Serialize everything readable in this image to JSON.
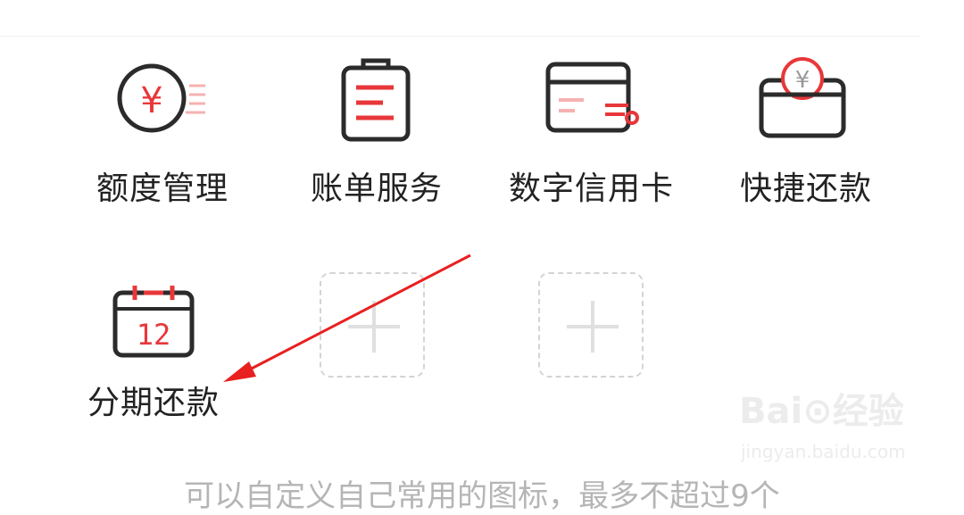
{
  "shortcuts": [
    {
      "label": "额度管理",
      "icon": "credit-limit-icon"
    },
    {
      "label": "账单服务",
      "icon": "bill-clipboard-icon"
    },
    {
      "label": "数字信用卡",
      "icon": "digital-card-icon"
    },
    {
      "label": "快捷还款",
      "icon": "wallet-coin-icon"
    },
    {
      "label": "分期还款",
      "icon": "calendar-icon"
    }
  ],
  "calendar_day": "12",
  "coin_symbol": "¥",
  "add_slots": [
    "add-slot",
    "add-slot"
  ],
  "hint": "可以自定义自己常用的图标，最多不超过9个",
  "watermark": {
    "logo": "Bai⊙经验",
    "url": "jingyan.baidu.com"
  },
  "colors": {
    "accent": "#e8373a",
    "stroke": "#2b2b2b",
    "accent_light": "#f6b1b1"
  }
}
